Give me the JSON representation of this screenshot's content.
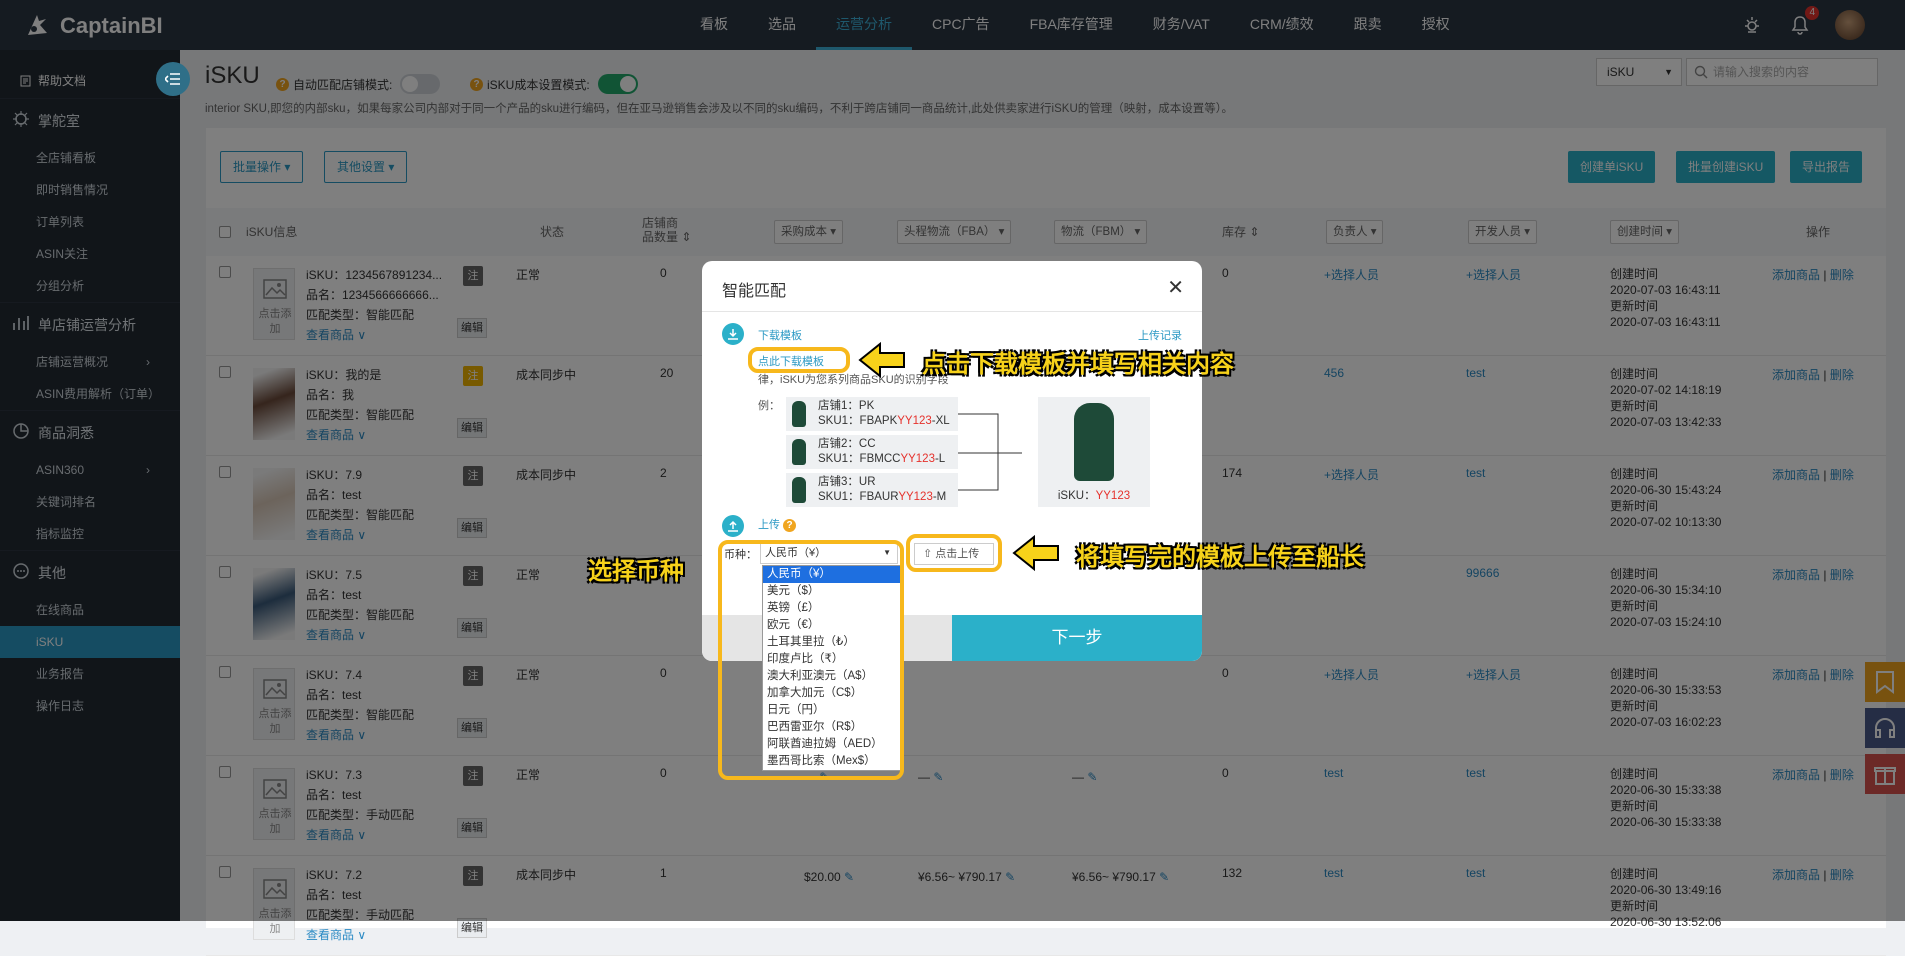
{
  "app": {
    "name": "CaptainBI"
  },
  "nav": [
    "看板",
    "选品",
    "运营分析",
    "CPC广告",
    "FBA库存管理",
    "财务/VAT",
    "CRM/绩效",
    "跟卖",
    "授权"
  ],
  "notif_count": "4",
  "sidebar": {
    "help": "帮助文档",
    "sections": [
      {
        "title": "掌舵室",
        "items": [
          "全店铺看板",
          "即时销售情况",
          "订单列表",
          "ASIN关注",
          "分组分析"
        ]
      },
      {
        "title": "单店铺运营分析",
        "items": [
          "店铺运营概况",
          "ASIN费用解析（订单）"
        ]
      },
      {
        "title": "商品洞悉",
        "items": [
          "ASIN360",
          "关键词排名",
          "指标监控"
        ]
      },
      {
        "title": "其他",
        "items": [
          "在线商品",
          "iSKU",
          "业务报告",
          "操作日志"
        ]
      }
    ]
  },
  "page": {
    "title": "iSKU",
    "auto_match_label": "自动匹配店铺模式:",
    "cost_mode_label": "iSKU成本设置模式:",
    "description": "interior SKU,即您的内部sku，如果每家公司内部对于同一个产品的sku进行编码，但在亚马逊销售会涉及以不同的sku编码，不利于跨店铺同一商品统计,此处供卖家进行iSKU的管理（映射，成本设置等）。",
    "search_type": "iSKU",
    "search_placeholder": "请输入搜索的内容"
  },
  "toolbar": {
    "batch": "批量操作",
    "other": "其他设置",
    "create_single": "创建单iSKU",
    "batch_create": "批量创建iSKU",
    "export": "导出报告"
  },
  "table": {
    "headers": {
      "info": "iSKU信息",
      "status": "状态",
      "shop_count_1": "店铺商",
      "shop_count_2": "品数量",
      "purchase": "采购成本",
      "fba": "头程物流（FBA）",
      "fbm": "物流（FBM）",
      "stock": "库存",
      "owner": "负责人",
      "dev": "开发人员",
      "created": "创建时间",
      "ops": "操作"
    },
    "rows": [
      {
        "isku": "iSKU：1234567891234...",
        "name": "品名：1234566666666...",
        "match": "匹配类型：智能匹配",
        "view": "查看商品",
        "tag": "注",
        "edit": "编辑",
        "status": "正常",
        "count": "0",
        "stock": "0",
        "owner": "+选择人员",
        "dev": "+选择人员",
        "c1": "创建时间",
        "c2": "2020-07-03 16:43:11",
        "u1": "更新时间",
        "u2": "2020-07-03 16:43:11",
        "add": "添加商品",
        "del": "删除",
        "thumb_txt": "点击添加"
      },
      {
        "isku": "iSKU：我的是",
        "name": "品名：我",
        "match": "匹配类型：智能匹配",
        "view": "查看商品",
        "tag": "注",
        "edit": "编辑",
        "status": "成本同步中",
        "count": "20",
        "stock": "",
        "owner": "456",
        "dev": "test",
        "c1": "创建时间",
        "c2": "2020-07-02 14:18:19",
        "u1": "更新时间",
        "u2": "2020-07-03 13:42:33",
        "add": "添加商品",
        "del": "删除"
      },
      {
        "isku": "iSKU：7.9",
        "name": "品名：test",
        "match": "匹配类型：智能匹配",
        "view": "查看商品",
        "tag": "注",
        "edit": "编辑",
        "status": "成本同步中",
        "count": "2",
        "stock": "174",
        "owner": "+选择人员",
        "dev": "test",
        "c1": "创建时间",
        "c2": "2020-06-30 15:43:24",
        "u1": "更新时间",
        "u2": "2020-07-02 10:13:30",
        "add": "添加商品",
        "del": "删除"
      },
      {
        "isku": "iSKU：7.5",
        "name": "品名：test",
        "match": "匹配类型：智能匹配",
        "view": "查看商品",
        "tag": "注",
        "edit": "编辑",
        "status": "正常",
        "count": "",
        "stock": "",
        "owner": "",
        "dev": "99666",
        "c1": "创建时间",
        "c2": "2020-06-30 15:34:10",
        "u1": "更新时间",
        "u2": "2020-07-03 15:24:10",
        "add": "添加商品",
        "del": "删除"
      },
      {
        "isku": "iSKU：7.4",
        "name": "品名：test",
        "match": "匹配类型：智能匹配",
        "view": "查看商品",
        "tag": "注",
        "edit": "编辑",
        "status": "正常",
        "count": "0",
        "stock": "0",
        "owner": "+选择人员",
        "dev": "+选择人员",
        "c1": "创建时间",
        "c2": "2020-06-30 15:33:53",
        "u1": "更新时间",
        "u2": "2020-07-03 16:02:23",
        "add": "添加商品",
        "del": "删除",
        "thumb_txt": "点击添加"
      },
      {
        "isku": "iSKU：7.3",
        "name": "品名：test",
        "match": "匹配类型：手动匹配",
        "view": "查看商品",
        "tag": "注",
        "edit": "编辑",
        "status": "正常",
        "count": "0",
        "stock": "0",
        "owner": "test",
        "dev": "test",
        "c1": "创建时间",
        "c2": "2020-06-30 15:33:38",
        "u1": "更新时间",
        "u2": "2020-06-30 15:33:38",
        "add": "添加商品",
        "del": "删除",
        "thumb_txt": "点击添加",
        "purchase": "—",
        "fba": "—",
        "fbm": "—"
      },
      {
        "isku": "iSKU：7.2",
        "name": "品名：test",
        "match": "匹配类型：手动匹配",
        "view": "查看商品",
        "tag": "注",
        "edit": "编辑",
        "status": "成本同步中",
        "count": "1",
        "stock": "132",
        "owner": "test",
        "dev": "test",
        "c1": "创建时间",
        "c2": "2020-06-30 13:49:16",
        "u1": "更新时间",
        "u2": "2020-06-30 13:52:06",
        "add": "添加商品",
        "del": "删除",
        "thumb_txt": "点击添加",
        "purchase": "$20.00",
        "fba": "¥6.56~ ¥790.17",
        "fbm": "¥6.56~ ¥790.17"
      }
    ]
  },
  "modal": {
    "title": "智能匹配",
    "download_label": "下载模板",
    "upload_record": "上传记录",
    "download_link": "点此下载模板",
    "hint": "律，iSKU为您系列商品SKU的识别字段",
    "example_label": "例：",
    "shops": [
      {
        "line1": "店铺1：PK",
        "pre": "SKU1：FBAPK",
        "hl": "YY123",
        "post": "-XL"
      },
      {
        "line1": "店铺2：CC",
        "pre": "SKU1：FBMCC",
        "hl": "YY123",
        "post": "-L"
      },
      {
        "line1": "店铺3：UR",
        "pre": "SKU1：FBAUR",
        "hl": "YY123",
        "post": "-M"
      }
    ],
    "isku_pre": "iSKU：",
    "isku_hl": "YY123",
    "upload_label": "上传",
    "currency_label": "币种：",
    "currency_value": "人民币（¥）",
    "upload_btn": "点击上传",
    "next": "下一步"
  },
  "currency_options": [
    "人民币（¥）",
    "美元（$）",
    "英镑（£）",
    "欧元（€）",
    "土耳其里拉（₺）",
    "印度卢比（₹）",
    "澳大利亚澳元（A$）",
    "加拿大加元（C$）",
    "日元（円）",
    "巴西雷亚尔（R$）",
    "阿联酋迪拉姆（AED）",
    "墨西哥比索（Mex$）"
  ],
  "annotations": {
    "download": "点击下载模板并填写相关内容",
    "currency": "选择币种",
    "upload": "将填写完的模板上传至船长"
  },
  "colors": {
    "accent": "#2b99c4",
    "topbar": "#2b3643",
    "sidebar": "#222a33",
    "annotation": "#f7b81c"
  }
}
